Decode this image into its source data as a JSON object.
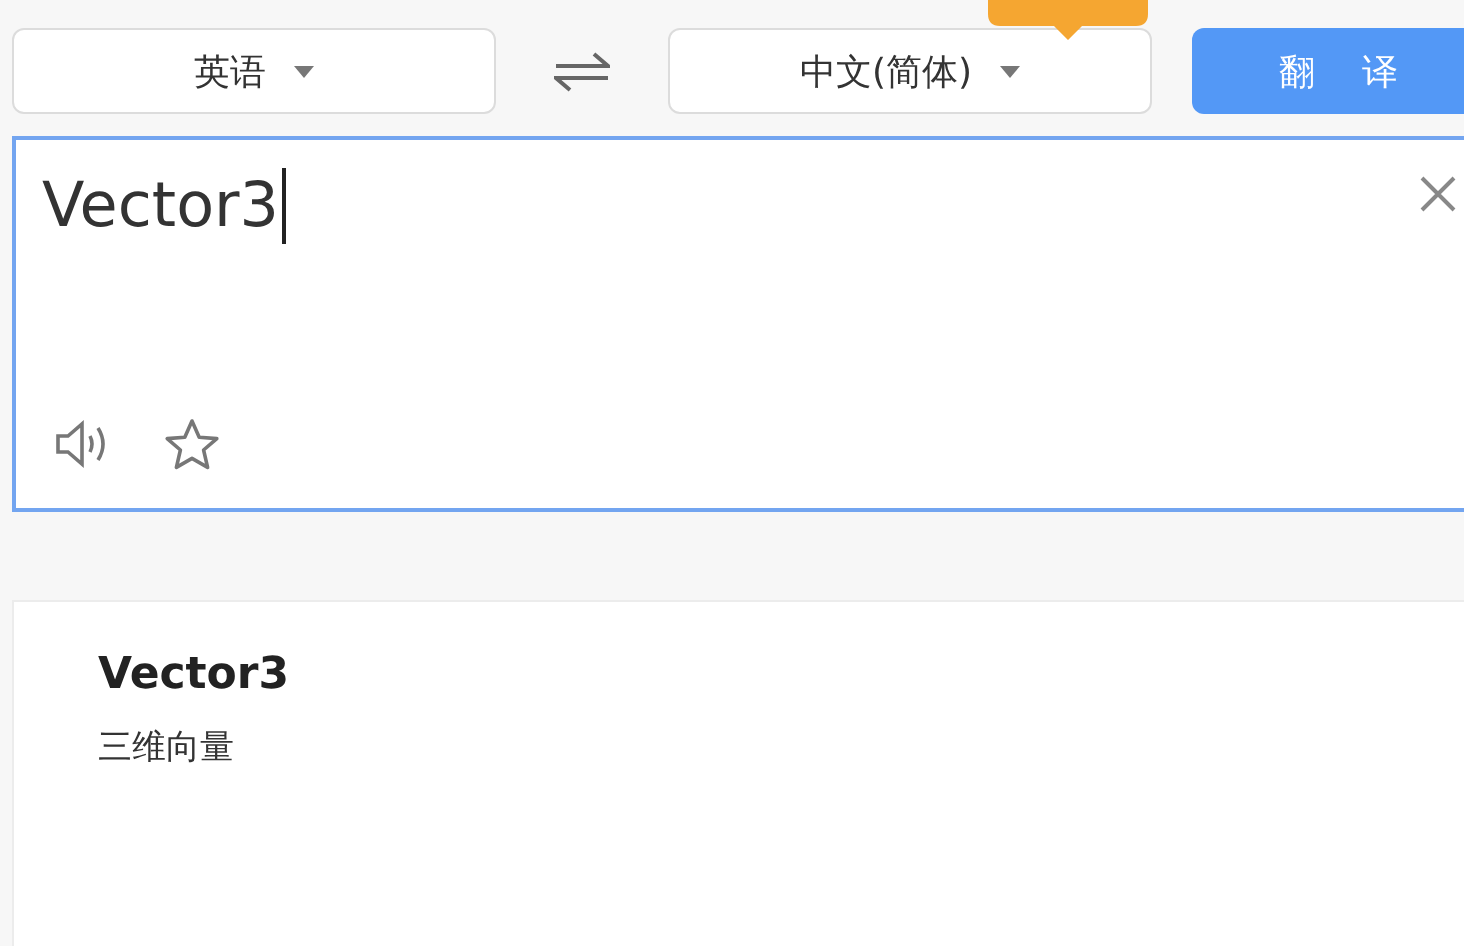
{
  "source_language": "英语",
  "target_language": "中文(简体)",
  "translate_button": "翻译",
  "input": {
    "value": "Vector3"
  },
  "result": {
    "word": "Vector3",
    "meaning": "三维向量"
  }
}
